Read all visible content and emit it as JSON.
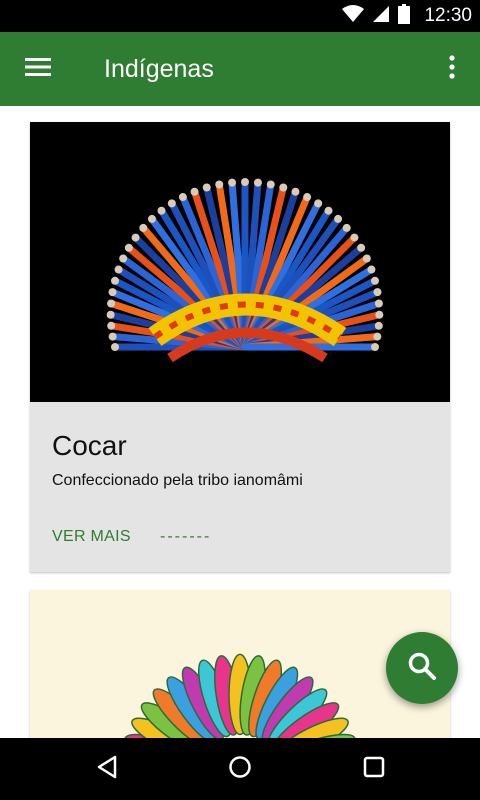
{
  "status_bar": {
    "time": "12:30",
    "icons": [
      "wifi-icon",
      "cell-signal-icon",
      "battery-icon"
    ]
  },
  "app_bar": {
    "title": "Indígenas",
    "menu_icon": "menu-icon",
    "overflow_icon": "more-vert-icon",
    "color": "#2e7d32"
  },
  "cards": [
    {
      "title": "Cocar",
      "subtitle": "Confeccionado pela tribo ianomâmi",
      "action_label": "VER MAIS",
      "secondary_action_label": "-------",
      "image": "feather-headdress-photo"
    },
    {
      "image": "colorful-feather-headdress-illustration"
    }
  ],
  "fab": {
    "icon": "search-icon"
  },
  "nav_bar": {
    "buttons": [
      "back-icon",
      "home-icon",
      "recents-icon"
    ]
  },
  "colors": {
    "accent": "#2e7d32",
    "card_bg": "#e4e4e4"
  }
}
